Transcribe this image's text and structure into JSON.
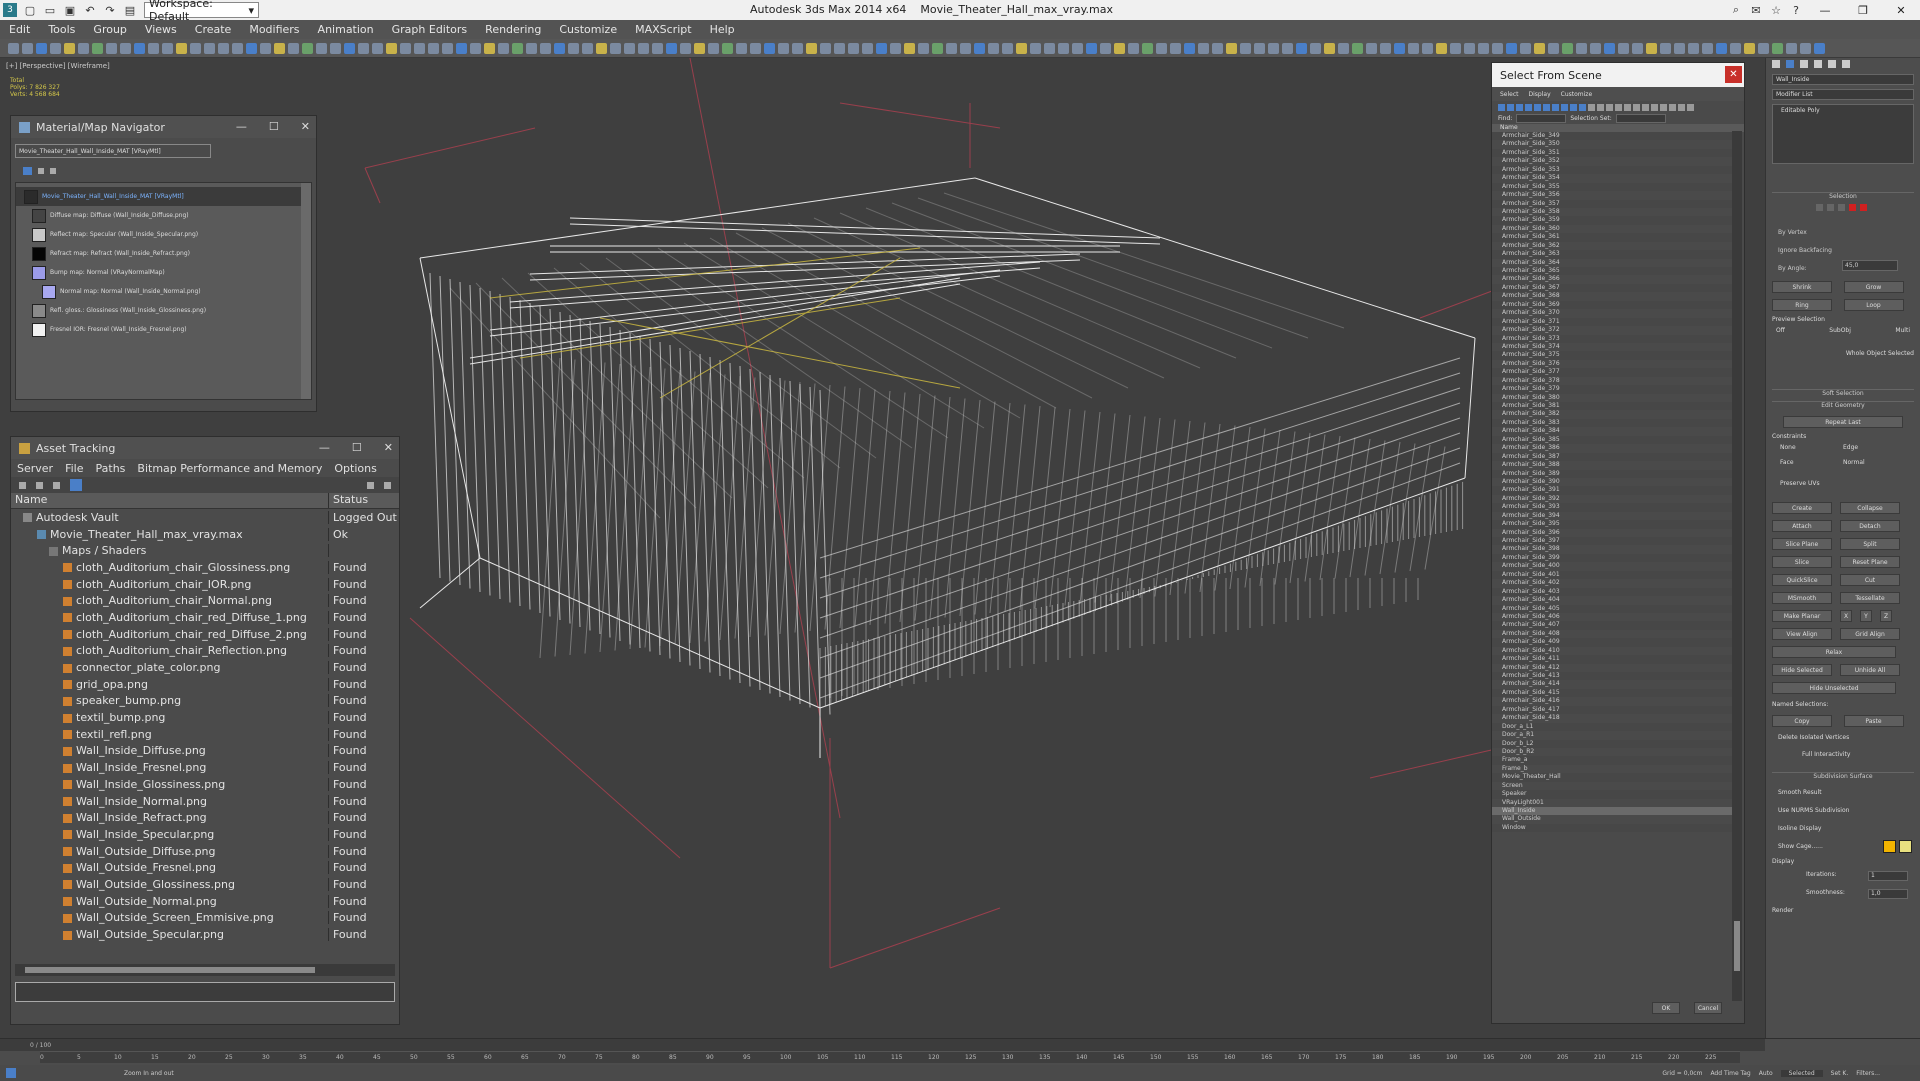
{
  "window": {
    "app_title": "Autodesk 3ds Max  2014 x64",
    "file_title": "Movie_Theater_Hall_max_vray.max",
    "workspace": "Workspace: Default"
  },
  "menu": [
    "Edit",
    "Tools",
    "Group",
    "Views",
    "Create",
    "Modifiers",
    "Animation",
    "Graph Editors",
    "Rendering",
    "Customize",
    "MAXScript",
    "Help"
  ],
  "viewport": {
    "label": "[+] [Perspective] [Wireframe]",
    "stats": [
      "Total",
      "Polys: 7 826 327",
      "Verts: 4 568 684"
    ]
  },
  "material_navigator": {
    "title": "Material/Map Navigator",
    "search": "Movie_Theater_Hall_Wall_Inside_MAT [VRayMtl]",
    "items": [
      {
        "label": "Movie_Theater_Hall_Wall_Inside_MAT [VRayMtl]",
        "color": "#2b2b2b"
      },
      {
        "label": "Diffuse map: Diffuse (Wall_Inside_Diffuse.png)",
        "color": "#444444"
      },
      {
        "label": "Reflect map: Specular (Wall_Inside_Specular.png)",
        "color": "#c8c8c8"
      },
      {
        "label": "Refract map: Refract (Wall_Inside_Refract.png)",
        "color": "#050505"
      },
      {
        "label": "Bump map: Normal (VRayNormalMap)",
        "color": "#9b9be8"
      },
      {
        "label": "Normal map: Normal (Wall_Inside_Normal.png)",
        "color": "#a8a8f0"
      },
      {
        "label": "Refl. gloss.: Glossiness (Wall_Inside_Glossiness.png)",
        "color": "#8a8a8a"
      },
      {
        "label": "Fresnel IOR: Fresnel (Wall_Inside_Fresnel.png)",
        "color": "#f2f2f2"
      }
    ]
  },
  "asset_tracking": {
    "title": "Asset Tracking",
    "menu": [
      "Server",
      "File",
      "Paths",
      "Bitmap Performance and Memory",
      "Options"
    ],
    "columns": [
      "Name",
      "Status"
    ],
    "rows": [
      {
        "name": "Autodesk Vault",
        "status": "Logged Out (..."
      },
      {
        "name": "Movie_Theater_Hall_max_vray.max",
        "status": "Ok"
      },
      {
        "name": "Maps / Shaders",
        "status": ""
      },
      {
        "name": "cloth_Auditorium_chair_Glossiness.png",
        "status": "Found"
      },
      {
        "name": "cloth_Auditorium_chair_IOR.png",
        "status": "Found"
      },
      {
        "name": "cloth_Auditorium_chair_Normal.png",
        "status": "Found"
      },
      {
        "name": "cloth_Auditorium_chair_red_Diffuse_1.png",
        "status": "Found"
      },
      {
        "name": "cloth_Auditorium_chair_red_Diffuse_2.png",
        "status": "Found"
      },
      {
        "name": "cloth_Auditorium_chair_Reflection.png",
        "status": "Found"
      },
      {
        "name": "connector_plate_color.png",
        "status": "Found"
      },
      {
        "name": "grid_opa.png",
        "status": "Found"
      },
      {
        "name": "speaker_bump.png",
        "status": "Found"
      },
      {
        "name": "textil_bump.png",
        "status": "Found"
      },
      {
        "name": "textil_refl.png",
        "status": "Found"
      },
      {
        "name": "Wall_Inside_Diffuse.png",
        "status": "Found"
      },
      {
        "name": "Wall_Inside_Fresnel.png",
        "status": "Found"
      },
      {
        "name": "Wall_Inside_Glossiness.png",
        "status": "Found"
      },
      {
        "name": "Wall_Inside_Normal.png",
        "status": "Found"
      },
      {
        "name": "Wall_Inside_Refract.png",
        "status": "Found"
      },
      {
        "name": "Wall_Inside_Specular.png",
        "status": "Found"
      },
      {
        "name": "Wall_Outside_Diffuse.png",
        "status": "Found"
      },
      {
        "name": "Wall_Outside_Fresnel.png",
        "status": "Found"
      },
      {
        "name": "Wall_Outside_Glossiness.png",
        "status": "Found"
      },
      {
        "name": "Wall_Outside_Normal.png",
        "status": "Found"
      },
      {
        "name": "Wall_Outside_Screen_Emmisive.png",
        "status": "Found"
      },
      {
        "name": "Wall_Outside_Specular.png",
        "status": "Found"
      }
    ]
  },
  "select_from_scene": {
    "title": "Select From Scene",
    "menu": [
      "Select",
      "Display",
      "Customize"
    ],
    "find_label": "Find:",
    "selection_set_label": "Selection Set:",
    "column": "Name",
    "ok": "OK",
    "cancel": "Cancel",
    "items": [
      "Armchair_Side_349",
      "Armchair_Side_350",
      "Armchair_Side_351",
      "Armchair_Side_352",
      "Armchair_Side_353",
      "Armchair_Side_354",
      "Armchair_Side_355",
      "Armchair_Side_356",
      "Armchair_Side_357",
      "Armchair_Side_358",
      "Armchair_Side_359",
      "Armchair_Side_360",
      "Armchair_Side_361",
      "Armchair_Side_362",
      "Armchair_Side_363",
      "Armchair_Side_364",
      "Armchair_Side_365",
      "Armchair_Side_366",
      "Armchair_Side_367",
      "Armchair_Side_368",
      "Armchair_Side_369",
      "Armchair_Side_370",
      "Armchair_Side_371",
      "Armchair_Side_372",
      "Armchair_Side_373",
      "Armchair_Side_374",
      "Armchair_Side_375",
      "Armchair_Side_376",
      "Armchair_Side_377",
      "Armchair_Side_378",
      "Armchair_Side_379",
      "Armchair_Side_380",
      "Armchair_Side_381",
      "Armchair_Side_382",
      "Armchair_Side_383",
      "Armchair_Side_384",
      "Armchair_Side_385",
      "Armchair_Side_386",
      "Armchair_Side_387",
      "Armchair_Side_388",
      "Armchair_Side_389",
      "Armchair_Side_390",
      "Armchair_Side_391",
      "Armchair_Side_392",
      "Armchair_Side_393",
      "Armchair_Side_394",
      "Armchair_Side_395",
      "Armchair_Side_396",
      "Armchair_Side_397",
      "Armchair_Side_398",
      "Armchair_Side_399",
      "Armchair_Side_400",
      "Armchair_Side_401",
      "Armchair_Side_402",
      "Armchair_Side_403",
      "Armchair_Side_404",
      "Armchair_Side_405",
      "Armchair_Side_406",
      "Armchair_Side_407",
      "Armchair_Side_408",
      "Armchair_Side_409",
      "Armchair_Side_410",
      "Armchair_Side_411",
      "Armchair_Side_412",
      "Armchair_Side_413",
      "Armchair_Side_414",
      "Armchair_Side_415",
      "Armchair_Side_416",
      "Armchair_Side_417",
      "Armchair_Side_418",
      "Door_a_L1",
      "Door_a_R1",
      "Door_b_L2",
      "Door_b_R2",
      "Frame_a",
      "Frame_b",
      "Movie_Theater_Hall",
      "Screen",
      "Speaker",
      "VRayLight001",
      "Wall_Inside",
      "Wall_Outside",
      "Window"
    ],
    "selected": "Wall_Inside"
  },
  "command_panel": {
    "object_name": "Wall_Inside",
    "modifier_list": "Modifier List",
    "modifier": "Editable Poly",
    "sections": [
      "Selection",
      "Soft Selection",
      "Edit Geometry",
      "Subdivision Surface"
    ],
    "selection_checks": [
      "By Vertex",
      "Ignore Backfacing",
      "By Angle:"
    ],
    "angle_value": "45,0",
    "sel_buttons": [
      "Shrink",
      "Grow",
      "Ring",
      "Loop"
    ],
    "preview_label": "Preview Selection",
    "preview_opts": [
      "Off",
      "SubObj",
      "Multi"
    ],
    "whole_object": "Whole Object Selected",
    "repeat_last": "Repeat Last",
    "constraints": "Constraints",
    "constraint_opts": [
      "None",
      "Edge",
      "Face",
      "Normal"
    ],
    "preserve_uvs": "Preserve UVs",
    "geo_buttons": [
      "Create",
      "Collapse",
      "Attach",
      "Detach",
      "Slice Plane",
      "Split",
      "Slice",
      "Reset Plane",
      "QuickSlice",
      "Cut",
      "MSmooth",
      "Tessellate",
      "Make Planar",
      "X",
      "Y",
      "Z",
      "View Align",
      "Grid Align",
      "Relax",
      "Hide Selected",
      "Unhide All",
      "Hide Unselected"
    ],
    "named_selections": "Named Selections:",
    "copy": "Copy",
    "paste": "Paste",
    "delete_isolated": "Delete Isolated Vertices",
    "full_interactivity": "Full Interactivity",
    "sub_opts": [
      "Smooth Result",
      "Use NURMS Subdivision",
      "Isoline Display",
      "Show Cage......"
    ],
    "display": "Display",
    "iterations_label": "Iterations:",
    "iterations": "1",
    "smoothness_label": "Smoothness:",
    "smoothness": "1,0",
    "render": "Render",
    "cage_colors": [
      "#f2b400",
      "#e8e080"
    ]
  },
  "timeline": {
    "frame": "0 / 100",
    "ticks": [
      "0",
      "5",
      "10",
      "15",
      "20",
      "25",
      "30",
      "35",
      "40",
      "45",
      "50",
      "55",
      "60",
      "65",
      "70",
      "75",
      "80",
      "85",
      "90",
      "95",
      "100",
      "105",
      "110",
      "115",
      "120",
      "125",
      "130",
      "135",
      "140",
      "145",
      "150",
      "155",
      "160",
      "165",
      "170",
      "175",
      "180",
      "185",
      "190",
      "195",
      "200",
      "205",
      "210",
      "215",
      "220",
      "225"
    ]
  },
  "status": {
    "prompt": "Zoom In and out",
    "grid": "Grid = 0,0cm",
    "add_time_tag": "Add Time Tag",
    "auto": "Auto",
    "selected": "Selected",
    "set_key": "Set K.",
    "filters": "Filters..."
  }
}
